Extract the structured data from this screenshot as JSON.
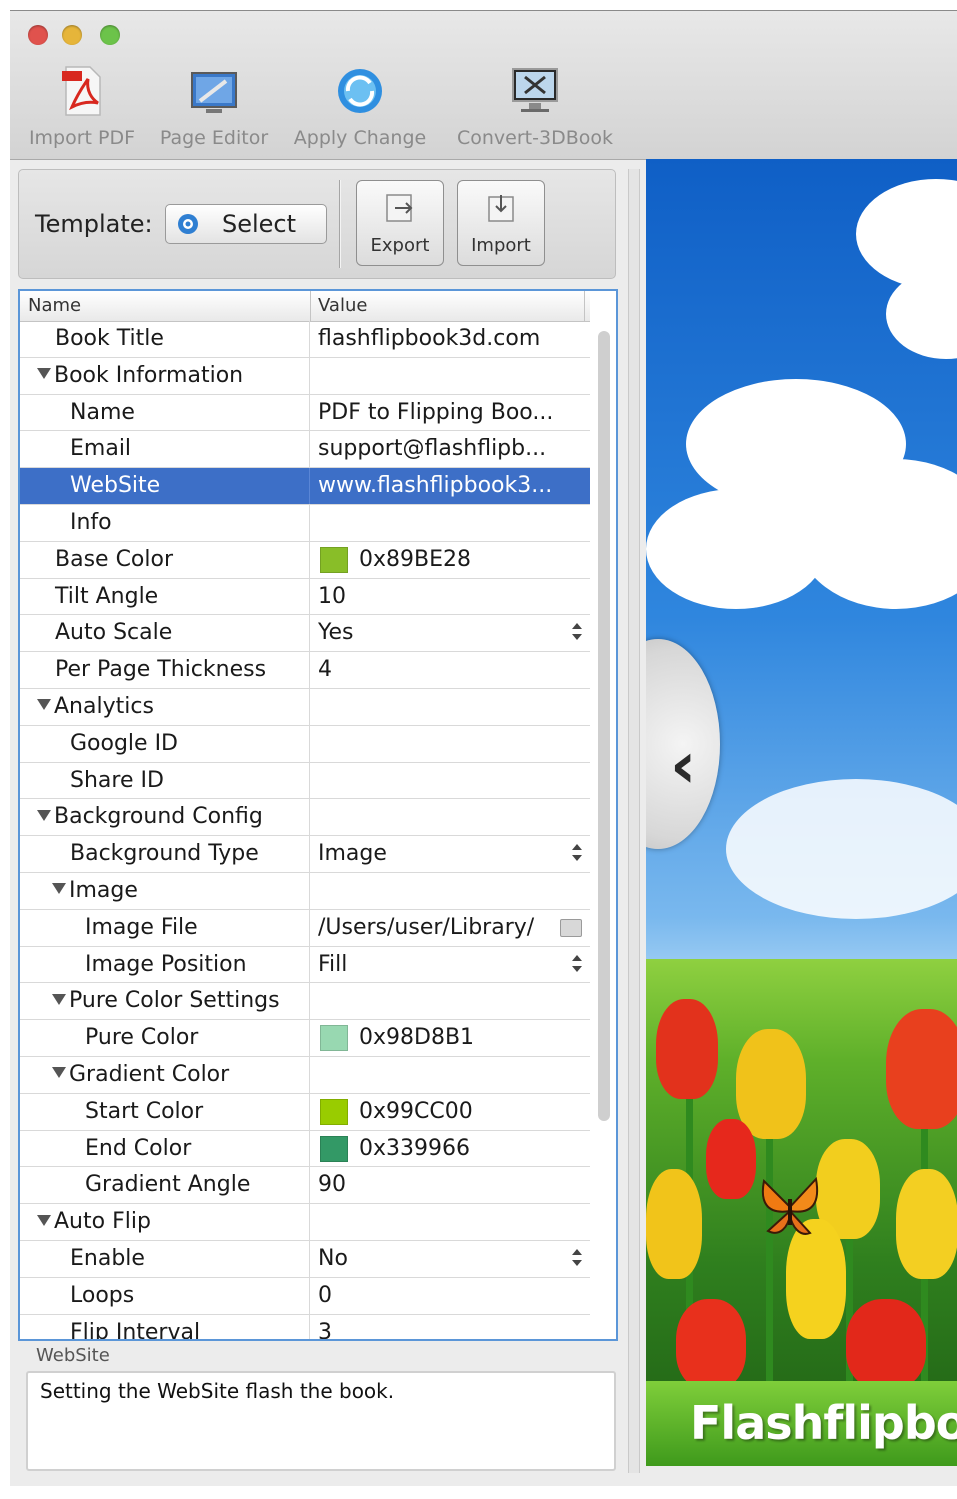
{
  "toolbar": {
    "buttons": [
      {
        "label": "Import PDF",
        "icon": "pdf-file-icon"
      },
      {
        "label": "Page Editor",
        "icon": "page-editor-icon"
      },
      {
        "label": "Apply Change",
        "icon": "apply-change-icon"
      },
      {
        "label": "Convert-3DBook",
        "icon": "convert-3dbook-icon"
      }
    ]
  },
  "template": {
    "label": "Template:",
    "select_label": "Select",
    "export_label": "Export",
    "import_label": "Import"
  },
  "grid": {
    "headers": {
      "name": "Name",
      "value": "Value"
    },
    "rows": [
      {
        "name": "Book Title",
        "value": "flashflipbook3d.com",
        "level": 1
      },
      {
        "name": "Book Information",
        "value": "",
        "level": 1,
        "group": true
      },
      {
        "name": "Name",
        "value": "PDF to Flipping Boo...",
        "level": 2
      },
      {
        "name": "Email",
        "value": "support@flashflipb...",
        "level": 2
      },
      {
        "name": "WebSite",
        "value": "www.flashflipbook3...",
        "level": 2,
        "selected": true
      },
      {
        "name": "Info",
        "value": "",
        "level": 2
      },
      {
        "name": "Base Color",
        "value": "0x89BE28",
        "level": 1,
        "swatch": "#89BE28"
      },
      {
        "name": "Tilt Angle",
        "value": "10",
        "level": 1
      },
      {
        "name": "Auto Scale",
        "value": "Yes",
        "level": 1,
        "dropdown": true
      },
      {
        "name": "Per Page Thickness",
        "value": "4",
        "level": 1
      },
      {
        "name": "Analytics",
        "value": "",
        "level": 1,
        "group": true
      },
      {
        "name": "Google ID",
        "value": "",
        "level": 2
      },
      {
        "name": "Share ID",
        "value": "",
        "level": 2
      },
      {
        "name": "Background Config",
        "value": "",
        "level": 1,
        "group": true
      },
      {
        "name": "Background Type",
        "value": "Image",
        "level": 2,
        "dropdown": true
      },
      {
        "name": "Image",
        "value": "",
        "level": 2,
        "group": true
      },
      {
        "name": "Image File",
        "value": "/Users/user/Library/",
        "level": 3,
        "folder": true
      },
      {
        "name": "Image Position",
        "value": "Fill",
        "level": 3,
        "dropdown": true
      },
      {
        "name": "Pure Color Settings",
        "value": "",
        "level": 2,
        "group": true
      },
      {
        "name": "Pure Color",
        "value": "0x98D8B1",
        "level": 3,
        "swatch": "#98D8B1"
      },
      {
        "name": "Gradient Color",
        "value": "",
        "level": 2,
        "group": true
      },
      {
        "name": "Start Color",
        "value": "0x99CC00",
        "level": 3,
        "swatch": "#99CC00"
      },
      {
        "name": "End Color",
        "value": "0x339966",
        "level": 3,
        "swatch": "#339966"
      },
      {
        "name": "Gradient Angle",
        "value": "90",
        "level": 3
      },
      {
        "name": "Auto Flip",
        "value": "",
        "level": 1,
        "group": true
      },
      {
        "name": "Enable",
        "value": "No",
        "level": 2,
        "dropdown": true
      },
      {
        "name": "Loops",
        "value": "0",
        "level": 2
      },
      {
        "name": "Flip Interval",
        "value": "3",
        "level": 2
      }
    ]
  },
  "description": {
    "title": "WebSite",
    "text": "Setting the WebSite flash the book."
  },
  "preview": {
    "brand_text": "Flashflipbo"
  },
  "colors": {
    "selection": "#3D6FC7",
    "grid_border": "#5B96D8",
    "brand_green": "#6CBF2F"
  }
}
